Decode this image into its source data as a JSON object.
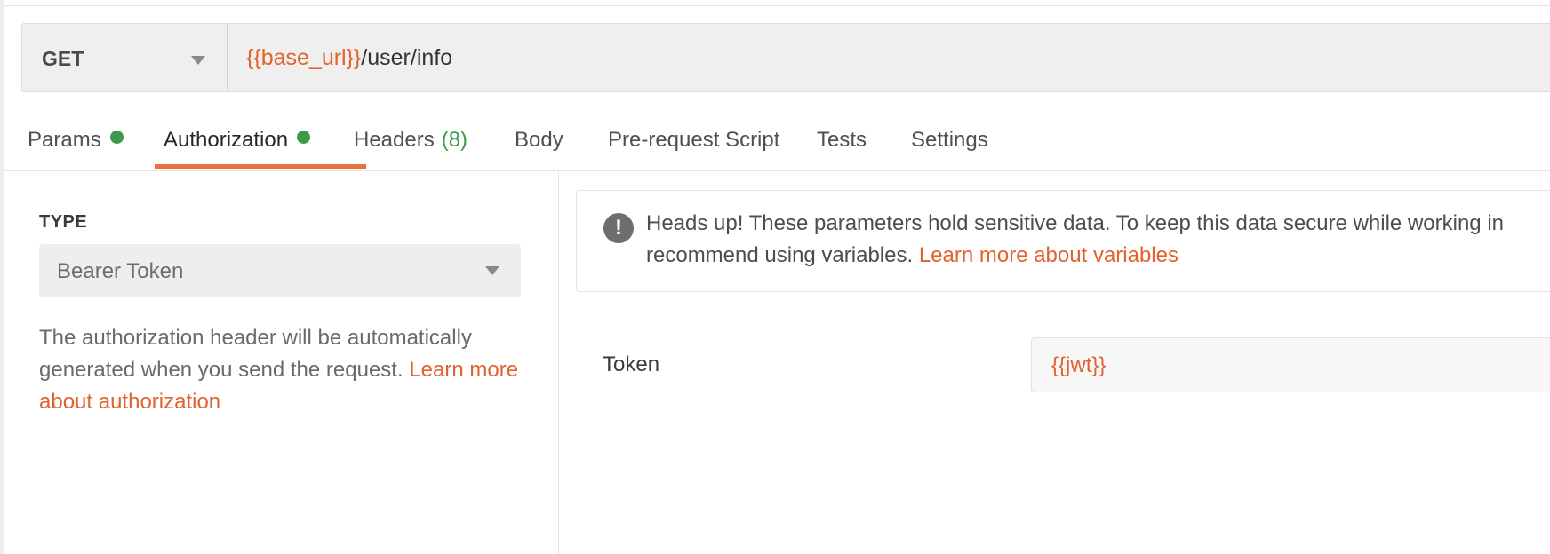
{
  "request": {
    "method": "GET",
    "url_variable": "{{base_url}}",
    "url_path": "/user/info"
  },
  "tabs": [
    {
      "label": "Params",
      "has_dot": true
    },
    {
      "label": "Authorization",
      "has_dot": true,
      "active": true
    },
    {
      "label": "Headers",
      "count": "(8)"
    },
    {
      "label": "Body"
    },
    {
      "label": "Pre-request Script"
    },
    {
      "label": "Tests"
    },
    {
      "label": "Settings"
    }
  ],
  "auth": {
    "type_heading": "TYPE",
    "type_value": "Bearer Token",
    "description": "The authorization header will be automatically generated when you send the request.",
    "description_link": "Learn more about authorization",
    "alert_text_line1": "Heads up! These parameters hold sensitive data. To keep this data secure while working in",
    "alert_text_line2": "recommend using variables.",
    "alert_link": "Learn more about variables",
    "token_label": "Token",
    "token_value": "{{jwt}}"
  },
  "icons": {
    "alert": "exclamation-circle-icon",
    "dropdown": "chevron-down-icon"
  },
  "colors": {
    "accent": "#e0632e",
    "active_tab_underline": "#e8703a",
    "status_dot": "#3c9a4c"
  }
}
